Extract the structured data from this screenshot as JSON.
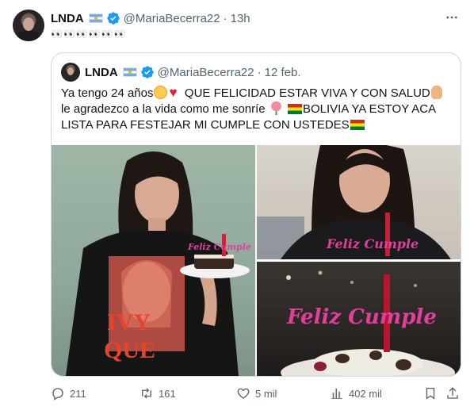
{
  "tweet": {
    "author_name": "LNDA",
    "handle": "@MariaBecerra22",
    "separator": "·",
    "time": "13h",
    "text": "👀👀👀👀👀👀",
    "more_icon": "ellipsis-icon",
    "verified_color": "#1d9bf0"
  },
  "quote": {
    "author_name": "LNDA",
    "handle": "@MariaBecerra22",
    "separator": "·",
    "date": "12 feb.",
    "line1_a": "Ya tengo 24 años",
    "line1_b": "QUE FELICIDAD ESTAR VIVA Y CON SALUD",
    "line2_a": "le agradezco a la vida como me sonríe",
    "line2_b": "BOLIVIA YA ESTOY ACA",
    "line3": "LISTA PARA FESTEJAR MI CUMPLE CON USTEDES",
    "photo1": {
      "shirt_text_1": "IVY",
      "shirt_text_2": "QUE",
      "cake_topper": "Feliz Cumple"
    },
    "photo2": {
      "cake_topper": "Feliz Cumple"
    },
    "photo3": {
      "cake_topper": "Feliz Cumple"
    }
  },
  "actions": {
    "replies": "211",
    "reposts": "161",
    "likes": "5 mil",
    "views": "402 mil"
  }
}
